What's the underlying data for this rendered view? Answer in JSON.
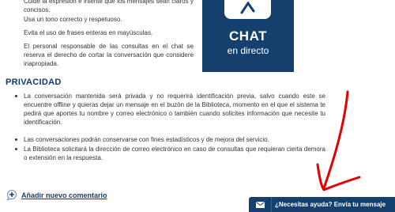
{
  "rules": {
    "lines": [
      "Cuide la expresión e intente que los mensajes sean claros y concisos.",
      "Usa un tono correcto y respetuoso.",
      "Evita el uso de frases enteras en mayúsculas.",
      "El personal responsable de las consultas en el chat se reserva el derecho de cortar la conversación que considere inapropiada."
    ]
  },
  "chat_banner": {
    "title": "CHAT",
    "subtitle": "en directo",
    "icon": "chat-bubble-icon"
  },
  "privacy": {
    "title": "PRIVACIDAD",
    "items": [
      "La conversación mantenida será privada y no requerirá identificación previa, salvo cuando este se encuentre offline y quieras dejar un mensaje en el buzón de la Biblioteca, momento en el que el sistema te pedirá que aportes tu nombre y correo electrónico o también cuando solicites información que necesite tu identificación.",
      "Las conversaciones podrán conservarse con fines estadísticos y de mejora del servicio.",
      "La Biblioteca solicitará la dirección de correo electrónico en caso de consultas que requieran cierta demora o extensión en la respuesta."
    ]
  },
  "add_comment": {
    "label": "Añadir nuevo comentario",
    "icon": "add-comment-icon"
  },
  "help_bar": {
    "label": "¿Necesitas ayuda? Envía tu mensaje",
    "icon": "envelope-icon"
  },
  "colors": {
    "brand": "#15406e",
    "annotation_arrow": "#e30000"
  }
}
